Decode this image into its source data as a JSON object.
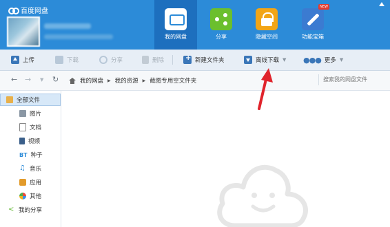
{
  "app": {
    "title": "百度网盘"
  },
  "header": {
    "tabs": [
      {
        "label": "我的网盘",
        "icon": "cloud-disk-icon",
        "active": true
      },
      {
        "label": "分享",
        "icon": "share-icon",
        "active": false
      },
      {
        "label": "隐藏空间",
        "icon": "lock-icon",
        "active": false
      },
      {
        "label": "功能宝箱",
        "icon": "toolbox-icon",
        "active": false,
        "badge": "NEW"
      }
    ]
  },
  "toolbar": {
    "upload": "上传",
    "download": "下载",
    "share": "分享",
    "delete": "删除",
    "new_folder": "新建文件夹",
    "offline_download": "离线下载",
    "more": "更多"
  },
  "address": {
    "crumbs": [
      "我的网盘",
      "我的资源",
      "截图专用空文件夹"
    ],
    "search_placeholder": "搜索我的网盘文件"
  },
  "sidebar": {
    "items": [
      {
        "label": "全部文件",
        "icon": "folder-icon",
        "active": true
      },
      {
        "label": "图片",
        "icon": "image-icon"
      },
      {
        "label": "文档",
        "icon": "document-icon"
      },
      {
        "label": "视频",
        "icon": "video-icon"
      },
      {
        "label": "种子",
        "icon": "torrent-icon",
        "prefix": "BT"
      },
      {
        "label": "音乐",
        "icon": "music-icon"
      },
      {
        "label": "应用",
        "icon": "app-icon"
      },
      {
        "label": "其他",
        "icon": "other-icon"
      },
      {
        "label": "我的分享",
        "icon": "share-icon"
      }
    ]
  },
  "colors": {
    "header_bg": "#2c8bd8",
    "active_tab": "#1d6fbe",
    "toolbar_bg": "#e7eef6",
    "arrow": "#e0242c"
  }
}
